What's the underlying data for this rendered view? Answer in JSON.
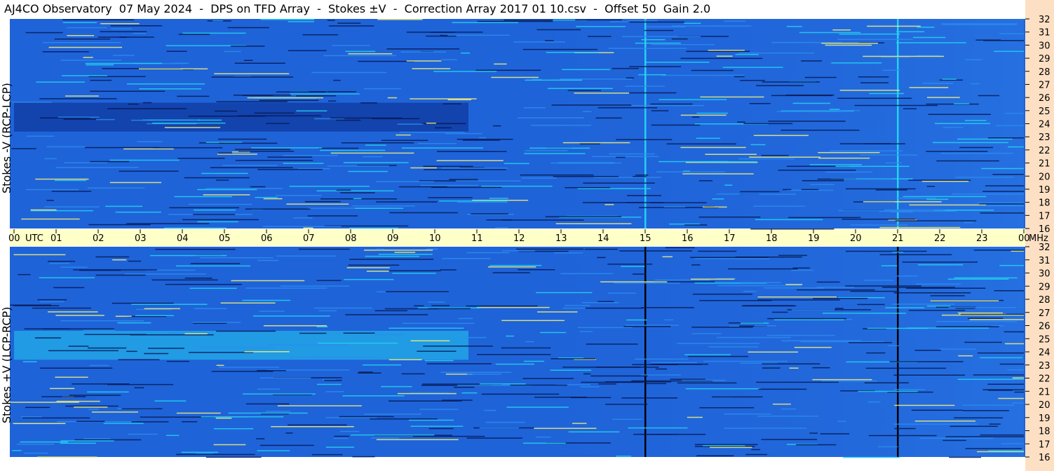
{
  "title": "AJ4CO Observatory  07 May 2024  -  DPS on TFD Array  -  Stokes ±V  -  Correction Array 2017 01 10.csv  -  Offset 50  Gain 2.0",
  "colors": {
    "background_blue": "#1f63d8",
    "deep_blue": "#0a2a8a",
    "cyan": "#23d3f0",
    "yellow": "#f5f07a",
    "timebar": "#ffffc8",
    "right_strip": "#fde0c4"
  },
  "chart_data": [
    {
      "type": "heatmap",
      "panel": "top",
      "ylabel": "Stokes -V (RCP-LCP)",
      "y_unit": "MHz",
      "y_ticks": [
        32,
        31,
        30,
        29,
        28,
        27,
        26,
        25,
        24,
        23,
        22,
        21,
        20,
        19,
        18,
        17,
        16
      ],
      "ylim": [
        16,
        32
      ],
      "x_range_utc_hours": [
        0,
        24
      ],
      "features": [
        {
          "kind": "dark band",
          "utc_start": 0.0,
          "utc_end": 10.8,
          "mhz_start": 23.4,
          "mhz_end": 25.6
        },
        {
          "kind": "vertical line",
          "utc": 15.0
        },
        {
          "kind": "vertical line",
          "utc": 21.0
        }
      ]
    },
    {
      "type": "heatmap",
      "panel": "bottom",
      "ylabel": "Stokes +V (LCP-RCP)",
      "y_unit": "MHz",
      "y_ticks": [
        32,
        31,
        30,
        29,
        28,
        27,
        26,
        25,
        24,
        23,
        22,
        21,
        20,
        19,
        18,
        17,
        16
      ],
      "ylim": [
        16,
        32
      ],
      "x_range_utc_hours": [
        0,
        24
      ],
      "features": [
        {
          "kind": "bright band",
          "utc_start": 0.0,
          "utc_end": 10.8,
          "mhz_start": 23.4,
          "mhz_end": 25.6
        },
        {
          "kind": "vertical line",
          "utc": 15.0
        },
        {
          "kind": "vertical line",
          "utc": 21.0
        }
      ]
    }
  ],
  "x_axis": {
    "tick_labels": [
      "00",
      "01",
      "02",
      "03",
      "04",
      "05",
      "06",
      "07",
      "08",
      "09",
      "10",
      "11",
      "12",
      "13",
      "14",
      "15",
      "16",
      "17",
      "18",
      "19",
      "20",
      "21",
      "22",
      "23",
      "00"
    ],
    "start_label": "UTC",
    "end_label": "MHz"
  }
}
